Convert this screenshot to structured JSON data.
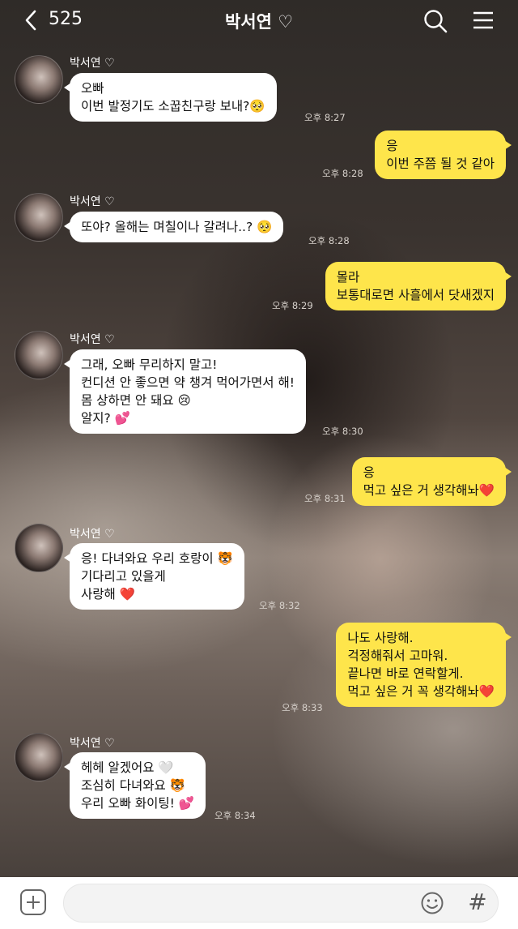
{
  "header": {
    "back_count": "525",
    "title": "박서연",
    "title_icon": "♡"
  },
  "messages": [
    {
      "type": "in",
      "sender": "박서연 ♡",
      "lines": [
        "오빠",
        "이번 발정기도 소꿉친구랑 보내?🥺"
      ],
      "time": "오후 8:27"
    },
    {
      "type": "out",
      "lines": [
        "응",
        "이번 주쯤 될 것 같아"
      ],
      "time": "오후 8:28"
    },
    {
      "type": "in",
      "sender": "박서연 ♡",
      "lines": [
        "또야? 올해는 며칠이나 갈려나..? 🥺"
      ],
      "time": "오후 8:28"
    },
    {
      "type": "out",
      "lines": [
        "몰라",
        "보통대로면 사흘에서 닷새겠지"
      ],
      "time": "오후 8:29"
    },
    {
      "type": "in",
      "sender": "박서연 ♡",
      "lines": [
        "그래, 오빠 무리하지 말고!",
        "컨디션 안 좋으면 약 챙겨 먹어가면서 해!",
        "몸 상하면 안 돼요 😢",
        "알지? 💕"
      ],
      "time": "오후 8:30"
    },
    {
      "type": "out",
      "lines": [
        "응",
        "먹고 싶은 거 생각해놔❤️"
      ],
      "time": "오후 8:31"
    },
    {
      "type": "in",
      "sender": "박서연 ♡",
      "lines": [
        "응! 다녀와요 우리 호랑이 🐯",
        "기다리고 있을게",
        "사랑해 ❤️"
      ],
      "time": "오후 8:32"
    },
    {
      "type": "out",
      "lines": [
        "나도 사랑해.",
        "걱정해줘서 고마워.",
        "끝나면 바로 연락할게.",
        "먹고 싶은 거 꼭 생각해놔❤️"
      ],
      "time": "오후 8:33"
    },
    {
      "type": "in",
      "sender": "박서연 ♡",
      "lines": [
        "헤헤 알겠어요 🤍",
        "조심히 다녀와요 🐯",
        "우리 오빠 화이팅! 💕"
      ],
      "time": "오후 8:34"
    }
  ],
  "input": {
    "placeholder": "",
    "value": ""
  },
  "icons": {
    "back": "chevron-left-icon",
    "search": "search-icon",
    "menu": "hamburger-menu-icon",
    "plus": "plus-icon",
    "emoji": "emoji-icon",
    "hash": "#"
  },
  "colors": {
    "outgoing_bubble": "#fee54b",
    "incoming_bubble": "#ffffff"
  }
}
